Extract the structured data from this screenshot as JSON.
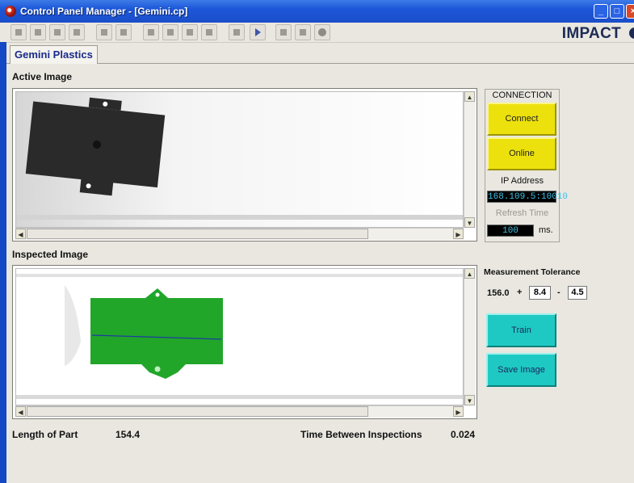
{
  "window": {
    "title": "Control Panel Manager - [Gemini.cp]",
    "brand": "IMPACT"
  },
  "tabs": [
    {
      "label": "Gemini Plastics"
    }
  ],
  "active_image": {
    "label": "Active Image"
  },
  "inspected_image": {
    "label": "Inspected Image"
  },
  "connection": {
    "header": "CONNECTION",
    "connect_label": "Connect",
    "online_label": "Online",
    "ip_label": "IP Address",
    "ip_value": "168.109.5:10010",
    "refresh_label": "Refresh Time",
    "refresh_value": "100",
    "refresh_unit": "ms."
  },
  "tolerance": {
    "label": "Measurement Tolerance",
    "nominal": "156.0",
    "plus_sign": "+",
    "plus_value": "8.4",
    "minus_sign": "-",
    "minus_value": "4.5"
  },
  "actions": {
    "train_label": "Train",
    "save_label": "Save Image"
  },
  "stats": {
    "length_label": "Length of Part",
    "length_value": "154.4",
    "time_label": "Time Between Inspections",
    "time_value": "0.024"
  },
  "colors": {
    "accent_yellow": "#ece10c",
    "accent_cyan": "#1fc9c3",
    "detect_green": "#21a62a",
    "lcd_text": "#3ec0e6"
  },
  "toolbar_icons": [
    "new-icon",
    "open-icon",
    "save-icon",
    "save-all-icon",
    "print-icon",
    "print-preview-icon",
    "cut-icon",
    "copy-icon",
    "paste-icon",
    "delete-icon",
    "find-icon",
    "run-icon",
    "properties-icon",
    "stop-icon",
    "record-icon"
  ]
}
